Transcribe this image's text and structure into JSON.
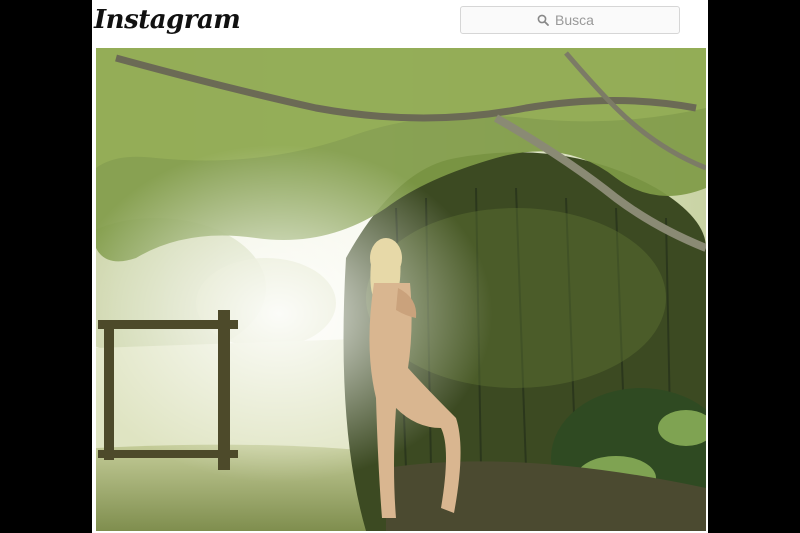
{
  "header": {
    "logo_text": "Instagram",
    "search": {
      "placeholder": "Busca",
      "icon": "search-icon"
    }
  },
  "post": {
    "image_subject": "woman-posing-in-garden",
    "colors": {
      "sky": "#f2f4e4",
      "foliage": "#6f8a3a",
      "hedge": "#2f3a1c",
      "grass": "#9aa86a",
      "gate": "#4d4a2a"
    }
  }
}
